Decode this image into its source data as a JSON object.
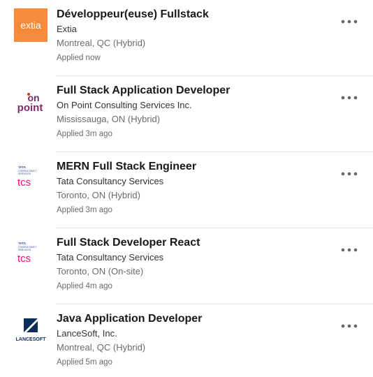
{
  "jobs": [
    {
      "title": "Développeur(euse) Fullstack",
      "company": "Extia",
      "location": "Montreal, QC (Hybrid)",
      "status": "Applied now",
      "logo": {
        "icon": "extia-logo",
        "text": "extia",
        "bg": "#f58a3b"
      }
    },
    {
      "title": "Full Stack Application Developer",
      "company": "On Point Consulting Services Inc.",
      "location": "Mississauga, ON (Hybrid)",
      "status": "Applied 3m ago",
      "logo": {
        "icon": "onpoint-logo",
        "text": "on point",
        "color": "#7a2a6b"
      }
    },
    {
      "title": "MERN Full Stack Engineer",
      "company": "Tata Consultancy Services",
      "location": "Toronto, ON (Hybrid)",
      "status": "Applied 3m ago",
      "logo": {
        "icon": "tcs-logo",
        "text": "tcs",
        "subtext": "TATA CONSULTANCY SERVICES"
      }
    },
    {
      "title": "Full Stack Developer React",
      "company": "Tata Consultancy Services",
      "location": "Toronto, ON (On-site)",
      "status": "Applied 4m ago",
      "logo": {
        "icon": "tcs-logo",
        "text": "tcs",
        "subtext": "TATA CONSULTANCY SERVICES"
      }
    },
    {
      "title": "Java Application Developer",
      "company": "LanceSoft, Inc.",
      "location": "Montreal, QC (Hybrid)",
      "status": "Applied 5m ago",
      "logo": {
        "icon": "lancesoft-logo",
        "text": "LANCESOFT",
        "color": "#0b2d5b"
      }
    }
  ],
  "more_icon": "ellipsis-horizontal-icon"
}
